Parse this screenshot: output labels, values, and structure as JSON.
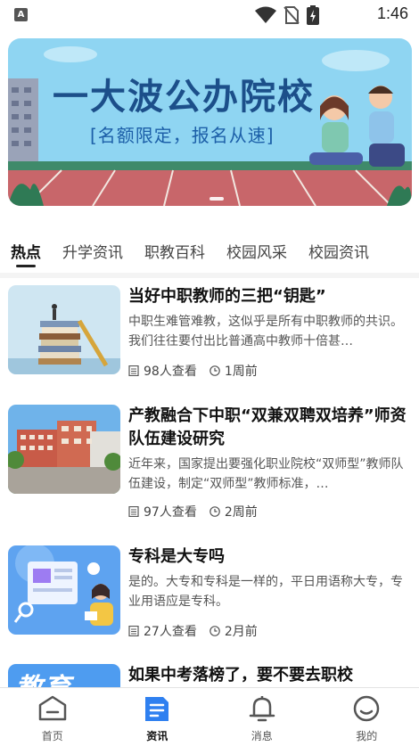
{
  "status_bar": {
    "time": "1:46",
    "badge": "A"
  },
  "banner": {
    "title": "一大波公办院校",
    "subtitle": "[名额限定，报名从速]"
  },
  "tabs": [
    {
      "label": "热点",
      "active": true
    },
    {
      "label": "升学资讯",
      "active": false
    },
    {
      "label": "职教百科",
      "active": false
    },
    {
      "label": "校园风采",
      "active": false
    },
    {
      "label": "校园资讯",
      "active": false
    }
  ],
  "articles": [
    {
      "title": "当好中职教师的三把“钥匙”",
      "desc": "中职生难管难教，这似乎是所有中职教师的共识。我们往往要付出比普通高中教师十倍甚…",
      "views": "98人查看",
      "time": "1周前"
    },
    {
      "title": "产教融合下中职“双兼双聘双培养”师资队伍建设研究",
      "desc": "近年来，国家提出要强化职业院校“双师型”教师队伍建设，制定“双师型”教师标准，…",
      "views": "97人查看",
      "time": "2周前"
    },
    {
      "title": "专科是大专吗",
      "desc": "是的。大专和专科是一样的，平日用语称大专，专业用语应是专科。",
      "views": "27人查看",
      "time": "2月前"
    },
    {
      "title": "如果中考落榜了，要不要去职校",
      "thumb_text": "教育"
    }
  ],
  "bottom_nav": [
    {
      "label": "首页",
      "icon": "home-icon",
      "active": false
    },
    {
      "label": "资讯",
      "icon": "news-icon",
      "active": true
    },
    {
      "label": "消息",
      "icon": "bell-icon",
      "active": false
    },
    {
      "label": "我的",
      "icon": "profile-icon",
      "active": false
    }
  ],
  "colors": {
    "accent": "#2f80f0",
    "banner_bg": "#8fd5f2",
    "banner_title": "#1c4f8a"
  }
}
